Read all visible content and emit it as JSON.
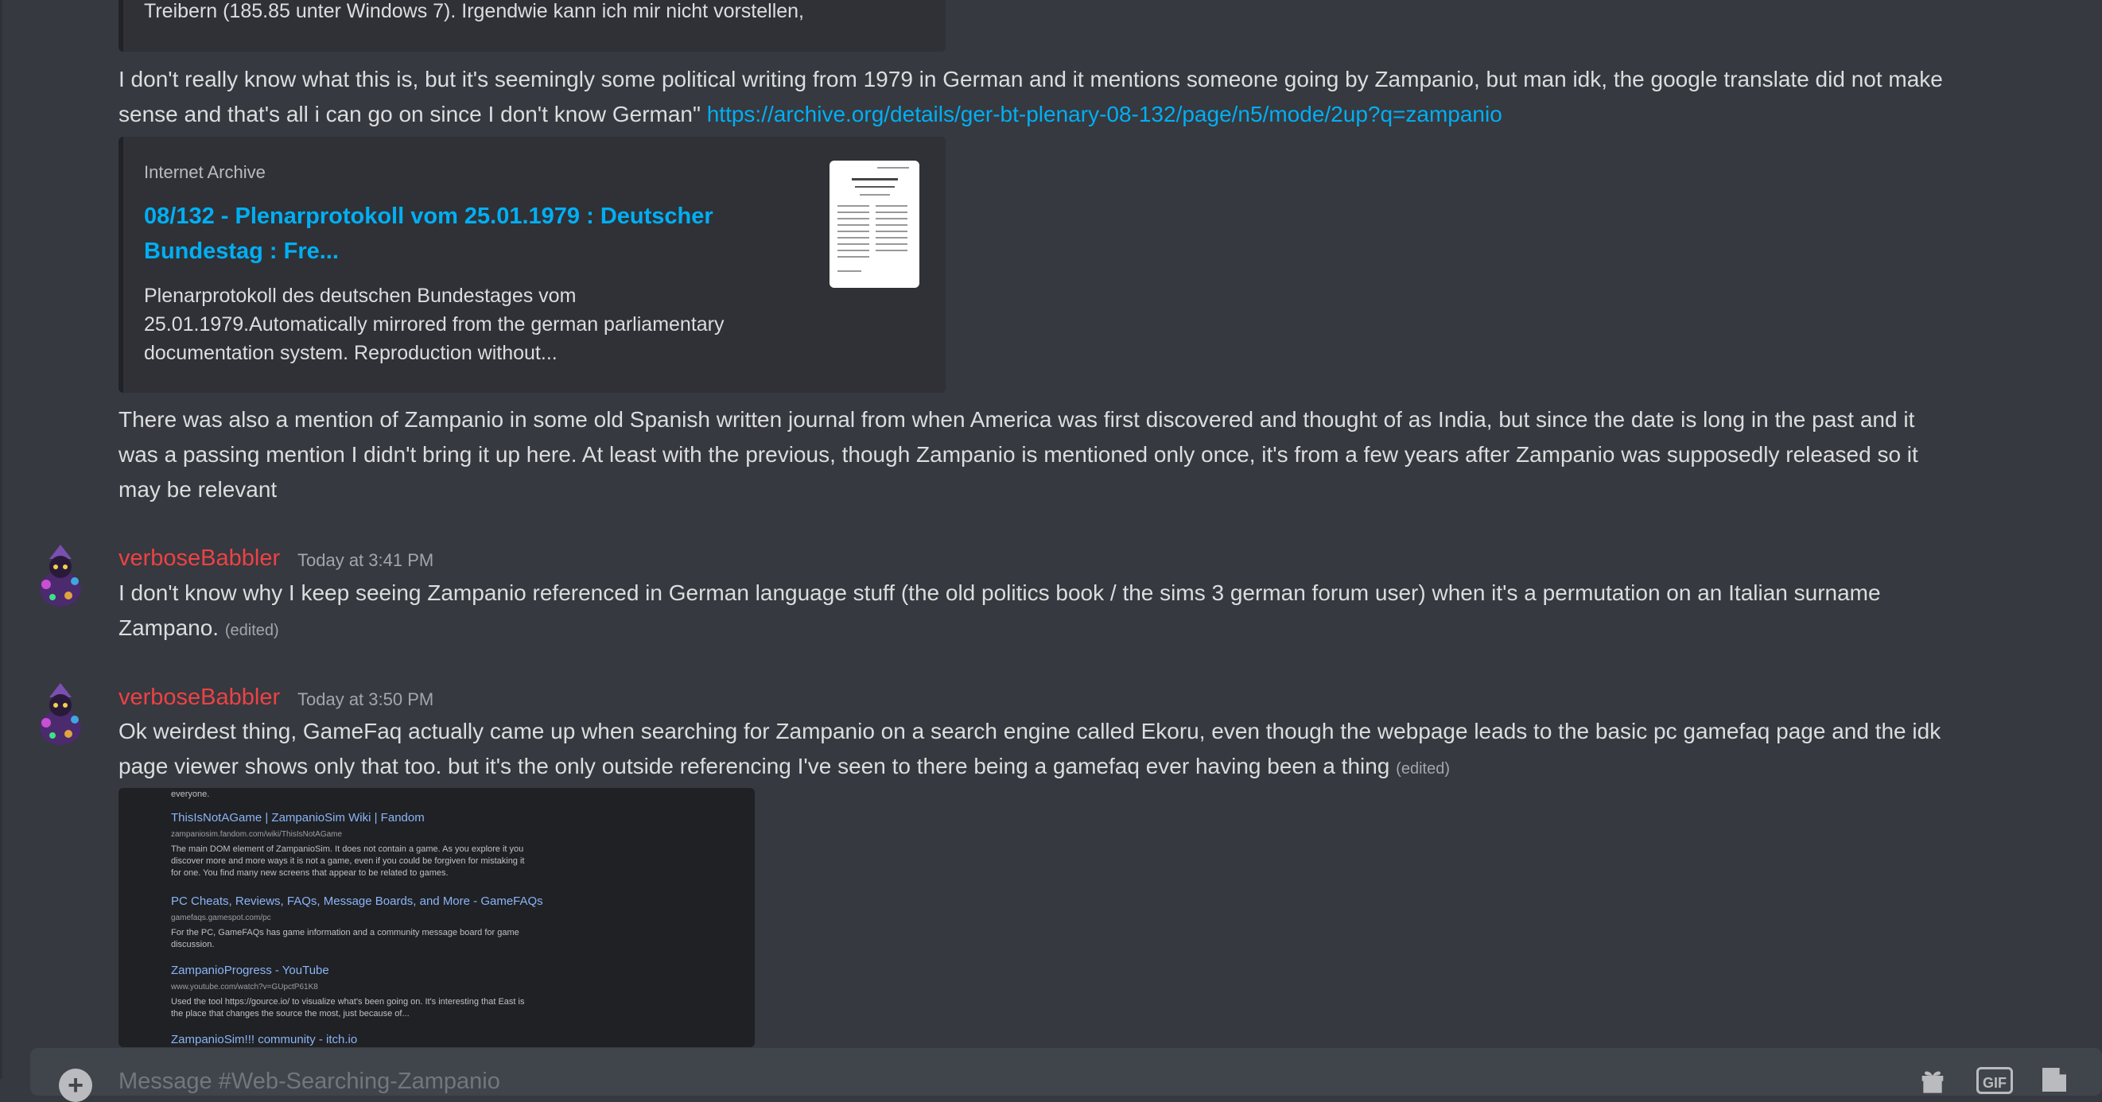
{
  "messages": {
    "top_embed_text": "Treibern (185.85 unter Windows 7). Irgendwie kann ich mir nicht vorstellen,",
    "msg1_line1": "I don't really know what this is, but it's seemingly some political writing from 1979 in German and it mentions someone going by Zampanio, but man idk, the google translate did not make",
    "msg1_line2": "sense and that's all i can go on since I don't know German\" ",
    "msg1_link": "https://archive.org/details/ger-bt-plenary-08-132/page/n5/mode/2up?q=zampanio",
    "embed": {
      "provider": "Internet Archive",
      "title": "08/132 - Plenarprotokoll vom 25.01.1979 : Deutscher Bundestag : Fre...",
      "description": "Plenarprotokoll des deutschen Bundestages vom 25.01.1979.Automatically mirrored from the german parliamentary documentation system. Reproduction without..."
    },
    "msg2_line1": "There was also a mention of Zampanio in some old Spanish written journal from when America was first discovered and thought of as India, but since the date is long in the past and it",
    "msg2_line2": "was a passing mention I didn't bring it up here. At least with the previous, though Zampanio is mentioned only once, it's from a few years after Zampanio was supposedly released so it",
    "msg2_line3": "may be relevant",
    "post1": {
      "username": "verboseBabbler",
      "timestamp": "Today at 3:41 PM",
      "line1": "I don't know why I keep seeing Zampanio referenced in German language stuff (the old politics book / the sims 3 german forum user) when it's a permutation on an Italian surname",
      "line2": "Zampano. ",
      "edited": "(edited)"
    },
    "post2": {
      "username": "verboseBabbler",
      "timestamp": "Today at 3:50 PM",
      "line1": "Ok weirdest thing, GameFaq actually came up when searching for Zampanio on a search engine called Ekoru, even though the webpage leads to the basic pc gamefaq page and the idk",
      "line2": "page viewer shows only that too. but it's the only outside referencing I've seen to there being a gamefaq ever having been a thing ",
      "edited": "(edited)"
    }
  },
  "screenshot": {
    "top_text": "everyone.",
    "results": [
      {
        "title": "ThisIsNotAGame | ZampanioSim Wiki | Fandom",
        "url": "zampaniosim.fandom.com/wiki/ThisIsNotAGame",
        "snippet_1": "The main DOM element of ZampanioSim. It does not contain a game. As you explore it you",
        "snippet_2": "discover more and more ways it is not a game, even if you could be forgiven for mistaking it",
        "snippet_3": "for one. You find many new screens that appear to be related to games."
      },
      {
        "title": "PC Cheats, Reviews, FAQs, Message Boards, and More - GameFAQs",
        "url": "gamefaqs.gamespot.com/pc",
        "snippet_1": "For the PC, GameFAQs has game information and a community message board for game",
        "snippet_2": "discussion."
      },
      {
        "title": "ZampanioProgress - YouTube",
        "url": "www.youtube.com/watch?v=GUpctP61K8",
        "snippet_1": "Used the tool https://gource.io/ to visualize what's been going on. It's interesting that East is",
        "snippet_2": "the place that changes the source the most, just because of..."
      },
      {
        "title": "ZampanioSim!!! community - itch.io"
      }
    ]
  },
  "composer": {
    "placeholder": "Message #Web-Searching-Zampanio"
  }
}
